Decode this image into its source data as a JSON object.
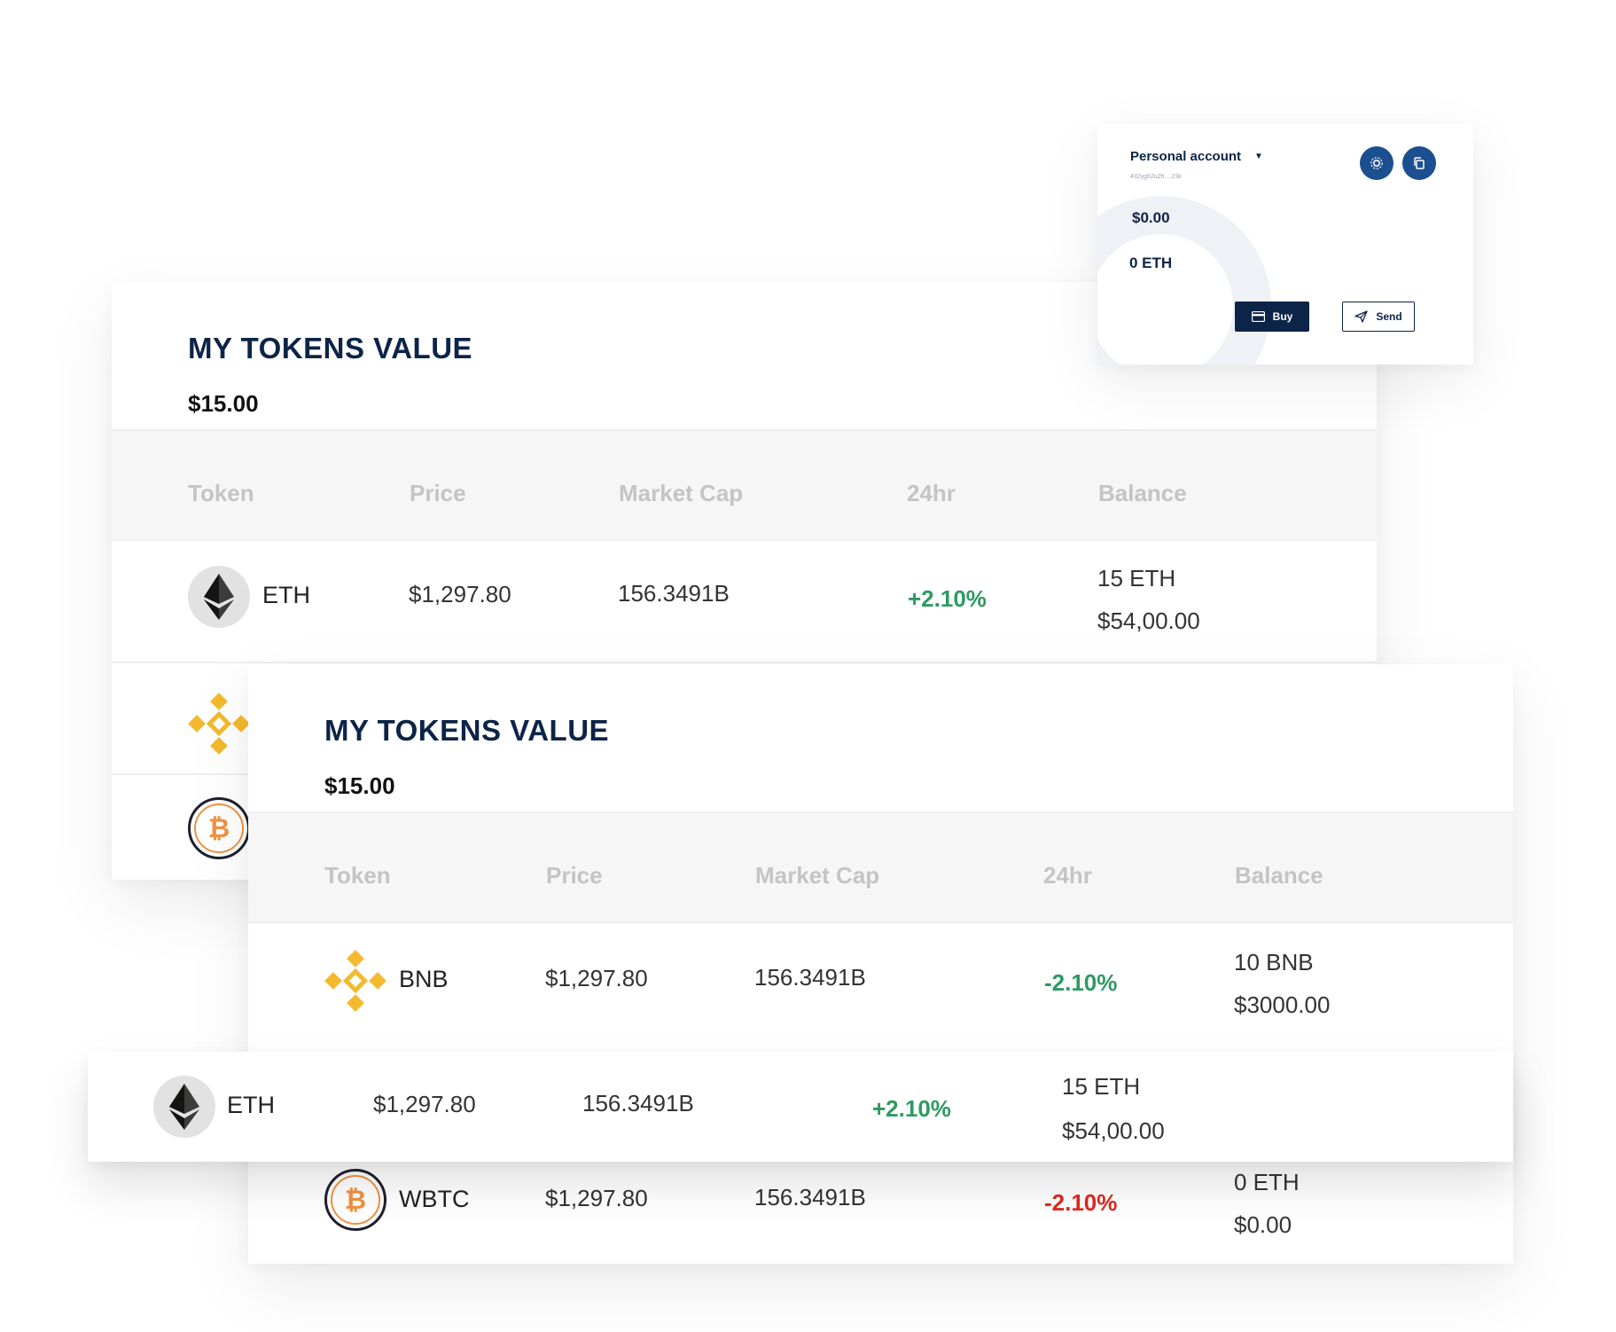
{
  "account_widget": {
    "title": "Personal account",
    "address": "432ygh2u2h....23k",
    "usd_balance": "$0.00",
    "eth_balance": "0 ETH",
    "buy_label": "Buy",
    "send_label": "Send"
  },
  "back_card": {
    "title": "MY TOKENS VALUE",
    "total": "$15.00",
    "columns": [
      "Token",
      "Price",
      "Market Cap",
      "24hr",
      "Balance"
    ],
    "rows": [
      {
        "symbol": "ETH",
        "price": "$1,297.80",
        "market_cap": "156.3491B",
        "change": "+2.10%",
        "balance_qty": "15 ETH",
        "balance_usd": "$54,00.00"
      }
    ]
  },
  "front_card": {
    "title": "MY TOKENS VALUE",
    "total": "$15.00",
    "columns": [
      "Token",
      "Price",
      "Market Cap",
      "24hr",
      "Balance"
    ],
    "rows": [
      {
        "symbol": "BNB",
        "price": "$1,297.80",
        "market_cap": "156.3491B",
        "change": "-2.10%",
        "balance_qty": "10 BNB",
        "balance_usd": "$3000.00"
      },
      {
        "symbol": "WBTC",
        "price": "$1,297.80",
        "market_cap": "156.3491B",
        "change": "-2.10%",
        "balance_qty": "0 ETH",
        "balance_usd": "$0.00"
      }
    ]
  },
  "floating_row": {
    "symbol": "ETH",
    "price": "$1,297.80",
    "market_cap": "156.3491B",
    "change": "+2.10%",
    "balance_qty": "15 ETH",
    "balance_usd": "$54,00.00"
  },
  "icons": {
    "eth": "ethereum-icon",
    "bnb": "binance-icon",
    "btc": "bitcoin-icon",
    "settings": "settings-icon",
    "copy": "copy-icon",
    "card": "card-icon",
    "send": "paper-plane-icon"
  },
  "colors": {
    "navy": "#0c2447",
    "positive": "#2d9a61",
    "negative": "#e0281f",
    "bnb": "#f3ba2f",
    "btc": "#f09242"
  }
}
